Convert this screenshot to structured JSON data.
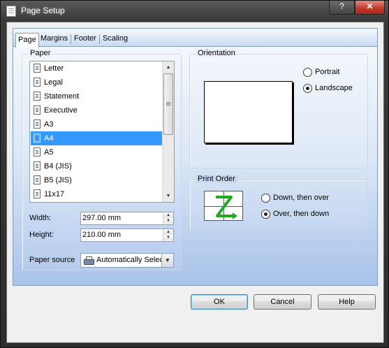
{
  "window": {
    "title": "Page Setup",
    "help_glyph": "?",
    "close_glyph": "✕"
  },
  "tabs": [
    {
      "label": "Page"
    },
    {
      "label": "Margins"
    },
    {
      "label": "Footer"
    },
    {
      "label": "Scaling"
    }
  ],
  "paper": {
    "group_label": "Paper",
    "items": [
      {
        "label": "Letter"
      },
      {
        "label": "Legal"
      },
      {
        "label": "Statement"
      },
      {
        "label": "Executive"
      },
      {
        "label": "A3"
      },
      {
        "label": "A4",
        "selected": true
      },
      {
        "label": "A5"
      },
      {
        "label": "B4 (JIS)"
      },
      {
        "label": "B5 (JIS)"
      },
      {
        "label": "11x17"
      }
    ],
    "width_label": "Width:",
    "width_value": "297.00 mm",
    "height_label": "Height:",
    "height_value": "210.00 mm",
    "source_label": "Paper source",
    "source_value": "Automatically Select"
  },
  "orientation": {
    "group_label": "Orientation",
    "options": [
      {
        "label": "Portrait",
        "checked": false
      },
      {
        "label": "Landscape",
        "checked": true
      }
    ]
  },
  "print_order": {
    "group_label": "Print Order",
    "options": [
      {
        "label": "Down, then over",
        "checked": false
      },
      {
        "label": "Over, then down",
        "checked": true
      }
    ]
  },
  "buttons": {
    "ok": "OK",
    "cancel": "Cancel",
    "help": "Help"
  },
  "colors": {
    "selection": "#3399ff",
    "panel_gradient_bottom": "#a9c3ea",
    "order_arrow": "#22aa22"
  }
}
